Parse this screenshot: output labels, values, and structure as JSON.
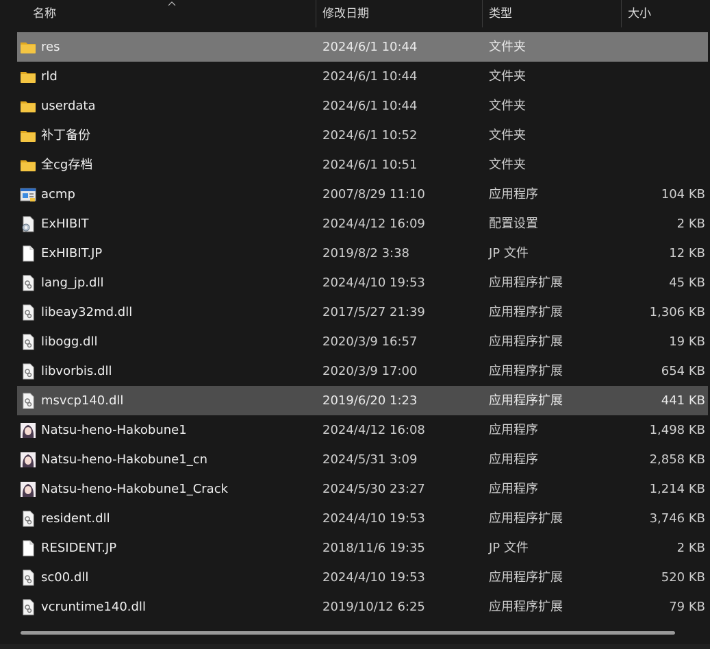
{
  "columns": {
    "name": "名称",
    "date": "修改日期",
    "type": "类型",
    "size": "大小"
  },
  "files": [
    {
      "name": "res",
      "date": "2024/6/1 10:44",
      "type": "文件夹",
      "size": "",
      "icon": "folder-icon",
      "state": "selected"
    },
    {
      "name": "rld",
      "date": "2024/6/1 10:44",
      "type": "文件夹",
      "size": "",
      "icon": "folder-icon",
      "state": ""
    },
    {
      "name": "userdata",
      "date": "2024/6/1 10:44",
      "type": "文件夹",
      "size": "",
      "icon": "folder-icon",
      "state": ""
    },
    {
      "name": "补丁备份",
      "date": "2024/6/1 10:52",
      "type": "文件夹",
      "size": "",
      "icon": "folder-icon",
      "state": ""
    },
    {
      "name": "全cg存档",
      "date": "2024/6/1 10:51",
      "type": "文件夹",
      "size": "",
      "icon": "folder-icon",
      "state": ""
    },
    {
      "name": "acmp",
      "date": "2007/8/29 11:10",
      "type": "应用程序",
      "size": "104 KB",
      "icon": "application-icon",
      "state": ""
    },
    {
      "name": "ExHIBIT",
      "date": "2024/4/12 16:09",
      "type": "配置设置",
      "size": "2 KB",
      "icon": "config-settings-icon",
      "state": ""
    },
    {
      "name": "ExHIBIT.JP",
      "date": "2019/8/2 3:38",
      "type": "JP 文件",
      "size": "12 KB",
      "icon": "blank-file-icon",
      "state": ""
    },
    {
      "name": "lang_jp.dll",
      "date": "2024/4/10 19:53",
      "type": "应用程序扩展",
      "size": "45 KB",
      "icon": "dll-file-icon",
      "state": ""
    },
    {
      "name": "libeay32md.dll",
      "date": "2017/5/27 21:39",
      "type": "应用程序扩展",
      "size": "1,306 KB",
      "icon": "dll-file-icon",
      "state": ""
    },
    {
      "name": "libogg.dll",
      "date": "2020/3/9 16:57",
      "type": "应用程序扩展",
      "size": "19 KB",
      "icon": "dll-file-icon",
      "state": ""
    },
    {
      "name": "libvorbis.dll",
      "date": "2020/3/9 17:00",
      "type": "应用程序扩展",
      "size": "654 KB",
      "icon": "dll-file-icon",
      "state": ""
    },
    {
      "name": "msvcp140.dll",
      "date": "2019/6/20 1:23",
      "type": "应用程序扩展",
      "size": "441 KB",
      "icon": "dll-file-icon",
      "state": "hover"
    },
    {
      "name": "Natsu-heno-Hakobune1",
      "date": "2024/4/12 16:08",
      "type": "应用程序",
      "size": "1,498 KB",
      "icon": "game-exe-icon",
      "state": ""
    },
    {
      "name": "Natsu-heno-Hakobune1_cn",
      "date": "2024/5/31 3:09",
      "type": "应用程序",
      "size": "2,858 KB",
      "icon": "game-exe-icon",
      "state": ""
    },
    {
      "name": "Natsu-heno-Hakobune1_Crack",
      "date": "2024/5/30 23:27",
      "type": "应用程序",
      "size": "1,214 KB",
      "icon": "game-exe-icon",
      "state": ""
    },
    {
      "name": "resident.dll",
      "date": "2024/4/10 19:53",
      "type": "应用程序扩展",
      "size": "3,746 KB",
      "icon": "dll-file-icon",
      "state": ""
    },
    {
      "name": "RESIDENT.JP",
      "date": "2018/11/6 19:35",
      "type": "JP 文件",
      "size": "2 KB",
      "icon": "blank-file-icon",
      "state": ""
    },
    {
      "name": "sc00.dll",
      "date": "2024/4/10 19:53",
      "type": "应用程序扩展",
      "size": "520 KB",
      "icon": "dll-file-icon",
      "state": ""
    },
    {
      "name": "vcruntime140.dll",
      "date": "2019/10/12 6:25",
      "type": "应用程序扩展",
      "size": "79 KB",
      "icon": "dll-file-icon",
      "state": ""
    }
  ],
  "colors": {
    "background": "#191919",
    "selected_row": "#777777",
    "hover_row": "#4d4d4d",
    "folder": "#f4c542"
  }
}
